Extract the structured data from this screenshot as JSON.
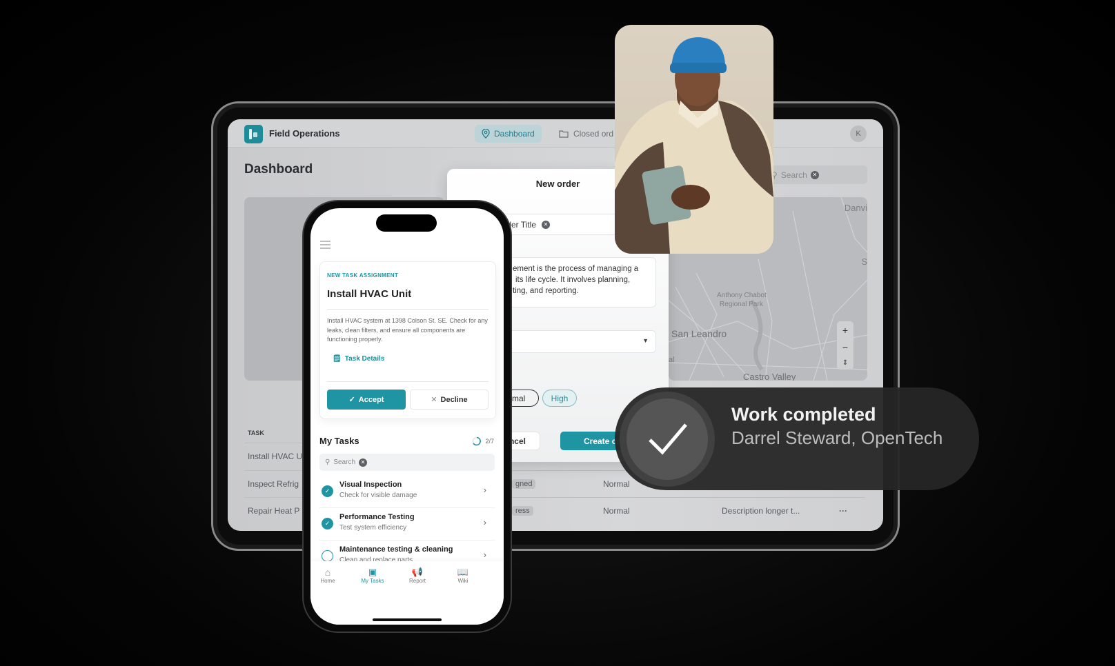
{
  "tablet": {
    "app_title": "Field Operations",
    "nav": [
      {
        "label": "Dashboard",
        "icon": "map-pin-icon",
        "active": true
      },
      {
        "label": "Closed ord",
        "icon": "folder-icon",
        "active": false
      }
    ],
    "avatar": "K",
    "page_title": "Dashboard",
    "search": {
      "placeholder": "Search"
    },
    "map": {
      "labels": [
        "Danvi",
        "S",
        "Anthony Chabot",
        "Regional Park",
        "San Leandro",
        "al",
        "Castro Valley"
      ],
      "controls": [
        "+",
        "−",
        "⇕"
      ]
    },
    "table": {
      "header": "TASK",
      "rows": [
        {
          "task": "Install HVAC U",
          "status": "",
          "priority": "",
          "description": ""
        },
        {
          "task": "Inspect Refrig",
          "status": "gned",
          "priority": "Normal",
          "description": ""
        },
        {
          "task": "Repair  Heat P",
          "status": "ress",
          "priority": "Normal",
          "description": "Description longer t...",
          "more": "···"
        }
      ]
    },
    "modal": {
      "title": "New order",
      "title_field": "Order Title",
      "description_lines": [
        "ement is the process of managing a",
        "its life cycle. It involves planning,",
        "ting, and reporting."
      ],
      "priority_options": [
        "Normal",
        "High"
      ],
      "selected_priority": "High",
      "cancel": "Cancel",
      "create": "Create order"
    }
  },
  "phone": {
    "card": {
      "eyebrow": "NEW TASK ASSIGNMENT",
      "title": "Install HVAC Unit",
      "description": "Install HVAC system at 1398 Colson St. SE. Check for any leaks, clean filters, and ensure all components are functioning properly.",
      "details_link": "Task Details",
      "accept": "Accept",
      "decline": "Decline"
    },
    "my_tasks": {
      "title": "My Tasks",
      "progress": "2/7",
      "progress_fraction": 0.2857,
      "search_placeholder": "Search"
    },
    "tasks": [
      {
        "title": "Visual Inspection",
        "subtitle": "Check for visible damage",
        "done": true
      },
      {
        "title": "Performance Testing",
        "subtitle": "Test system efficiency",
        "done": true
      },
      {
        "title": "Maintenance testing & cleaning",
        "subtitle": "Clean and replace parts",
        "done": false
      }
    ],
    "bottom_nav": [
      {
        "label": "Home",
        "icon": "home-icon"
      },
      {
        "label": "My Tasks",
        "icon": "tasks-icon",
        "active": true
      },
      {
        "label": "Report",
        "icon": "megaphone-icon"
      },
      {
        "label": "Wiki",
        "icon": "book-icon"
      }
    ]
  },
  "toast": {
    "title": "Work completed",
    "subtitle": "Darrel Steward, OpenTech",
    "icon": "checkmark-icon"
  },
  "colors": {
    "accent": "#1f95a3",
    "background": "#000000",
    "toast": "#262626"
  }
}
